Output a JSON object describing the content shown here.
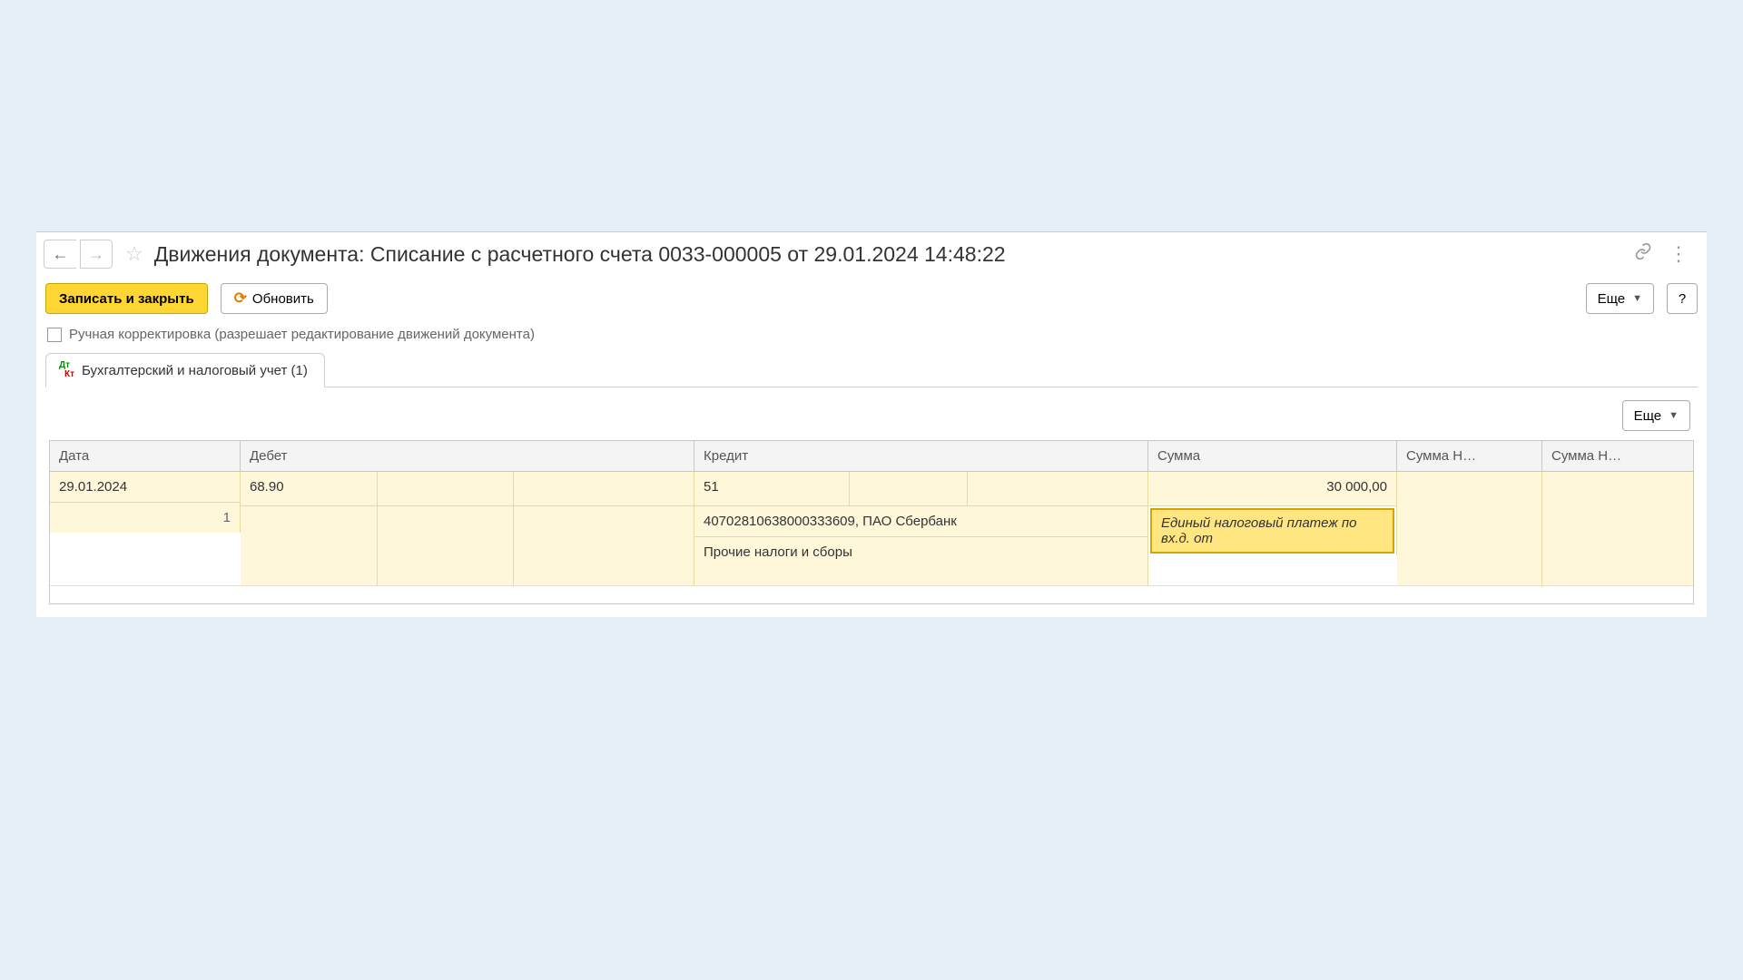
{
  "title": "Движения документа: Списание с расчетного счета 0033-000005 от 29.01.2024 14:48:22",
  "toolbar": {
    "save_close_label": "Записать и закрыть",
    "refresh_label": "Обновить",
    "more_label": "Еще",
    "help_label": "?"
  },
  "manual_edit": {
    "label": "Ручная корректировка (разрешает редактирование движений документа)",
    "checked": false
  },
  "tabs": [
    {
      "label": "Бухгалтерский и налоговый учет (1)"
    }
  ],
  "tab_toolbar": {
    "more_label": "Еще"
  },
  "grid": {
    "headers": {
      "date": "Дата",
      "debit": "Дебет",
      "credit": "Кредит",
      "sum": "Сумма",
      "sum_n1": "Сумма Н…",
      "sum_n2": "Сумма Н…"
    },
    "rows": [
      {
        "date": "29.01.2024",
        "row_number": "1",
        "debit_account": "68.90",
        "credit_account": "51",
        "credit_detail1": "40702810638000333609, ПАО Сбербанк",
        "credit_detail2": "Прочие налоги и сборы",
        "sum": "30 000,00",
        "sum_note": "Единый налоговый платеж по вх.д.  от"
      }
    ]
  }
}
